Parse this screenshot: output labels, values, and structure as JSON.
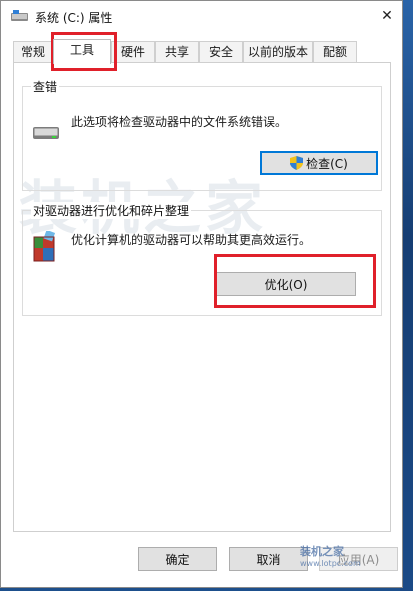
{
  "window": {
    "title": "系统 (C:) 属性",
    "close_glyph": "✕"
  },
  "tabs": [
    {
      "label": "常规"
    },
    {
      "label": "工具",
      "active": true
    },
    {
      "label": "硬件"
    },
    {
      "label": "共享"
    },
    {
      "label": "安全"
    },
    {
      "label": "以前的版本"
    },
    {
      "label": "配额"
    }
  ],
  "check_group": {
    "title": "查错",
    "description": "此选项将检查驱动器中的文件系统错误。",
    "button_label": "检查(C)",
    "icon": "drive-icon"
  },
  "optimize_group": {
    "title": "对驱动器进行优化和碎片整理",
    "description": "优化计算机的驱动器可以帮助其更高效运行。",
    "button_label": "优化(O)",
    "icon": "defrag-icon"
  },
  "footer": {
    "ok_label": "确定",
    "cancel_label": "取消",
    "apply_label": "应用(A)"
  },
  "watermark": {
    "text": "装机之家",
    "brand": "装机之家",
    "url": "www.lotpc.com"
  },
  "colors": {
    "highlight": "#e0202a",
    "focus": "#0078d7",
    "desktop": "#1d4f8c"
  }
}
